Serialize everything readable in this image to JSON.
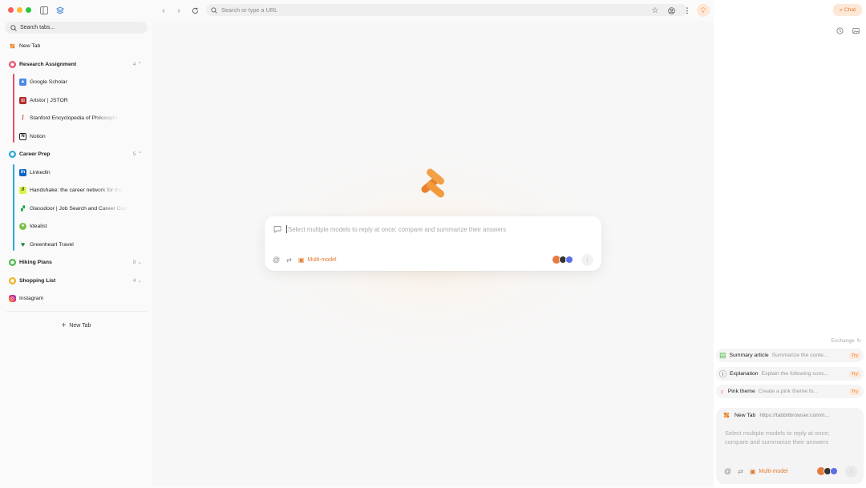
{
  "colors": {
    "accent": "#e07a2c",
    "close": "#ff5f57",
    "minimize": "#febc2e",
    "maximize": "#28c840"
  },
  "sidebar": {
    "search_placeholder": "Search tabs...",
    "new_tab_item": "New Tab",
    "groups": [
      {
        "name": "Research Assignment",
        "count": "4",
        "expanded": true,
        "color": "#e8506a",
        "tabs": [
          {
            "title": "Google Scholar",
            "icon": "google-scholar-icon"
          },
          {
            "title": "Artstor | JSTOR",
            "icon": "jstor-icon"
          },
          {
            "title": "Stanford Encyclopedia of Philosophy",
            "icon": "stanford-icon"
          },
          {
            "title": "Notion",
            "icon": "notion-icon"
          }
        ]
      },
      {
        "name": "Career Prep",
        "count": "5",
        "expanded": true,
        "color": "#2ea7d8",
        "tabs": [
          {
            "title": "LinkedIn",
            "icon": "linkedin-icon"
          },
          {
            "title": "Handshake: the career network for the",
            "icon": "handshake-icon"
          },
          {
            "title": "Glassdoor | Job Search and Career Com",
            "icon": "glassdoor-icon"
          },
          {
            "title": "Idealist",
            "icon": "idealist-icon"
          },
          {
            "title": "Greenheart Travel",
            "icon": "greenheart-icon"
          }
        ]
      },
      {
        "name": "Hiking Plans",
        "count": "8",
        "expanded": false,
        "color": "#4cb84c"
      },
      {
        "name": "Shopping List",
        "count": "4",
        "expanded": false,
        "color": "#f0b020"
      }
    ],
    "loose_tabs": [
      {
        "title": "Instagram",
        "icon": "instagram-icon"
      }
    ],
    "new_tab_button": "New Tab"
  },
  "toolbar": {
    "url_placeholder": "Search or type a URL"
  },
  "main": {
    "prompt_placeholder": "Select multiple models to reply at once; compare and summarize their answers",
    "multi_model_label": "Multi-model"
  },
  "right_panel": {
    "chat_button": "Chat",
    "exchange_label": "Exchange",
    "suggestions": [
      {
        "title": "Summary article",
        "desc": "Summarize the conte...",
        "try": "Try",
        "icon": "summary-icon"
      },
      {
        "title": "Explanation",
        "desc": "Explain the following conc...",
        "try": "Try",
        "icon": "question-icon"
      },
      {
        "title": "Pink theme",
        "desc": "Create a pink theme fo...",
        "try": "Try",
        "icon": "bulb-icon"
      }
    ],
    "chat": {
      "tab_title": "New Tab",
      "tab_url": "https://tabbitbrowser.com/n...",
      "placeholder": "Select multiple models to reply at once; compare and summarize their answers",
      "multi_model_label": "Multi-model"
    }
  }
}
